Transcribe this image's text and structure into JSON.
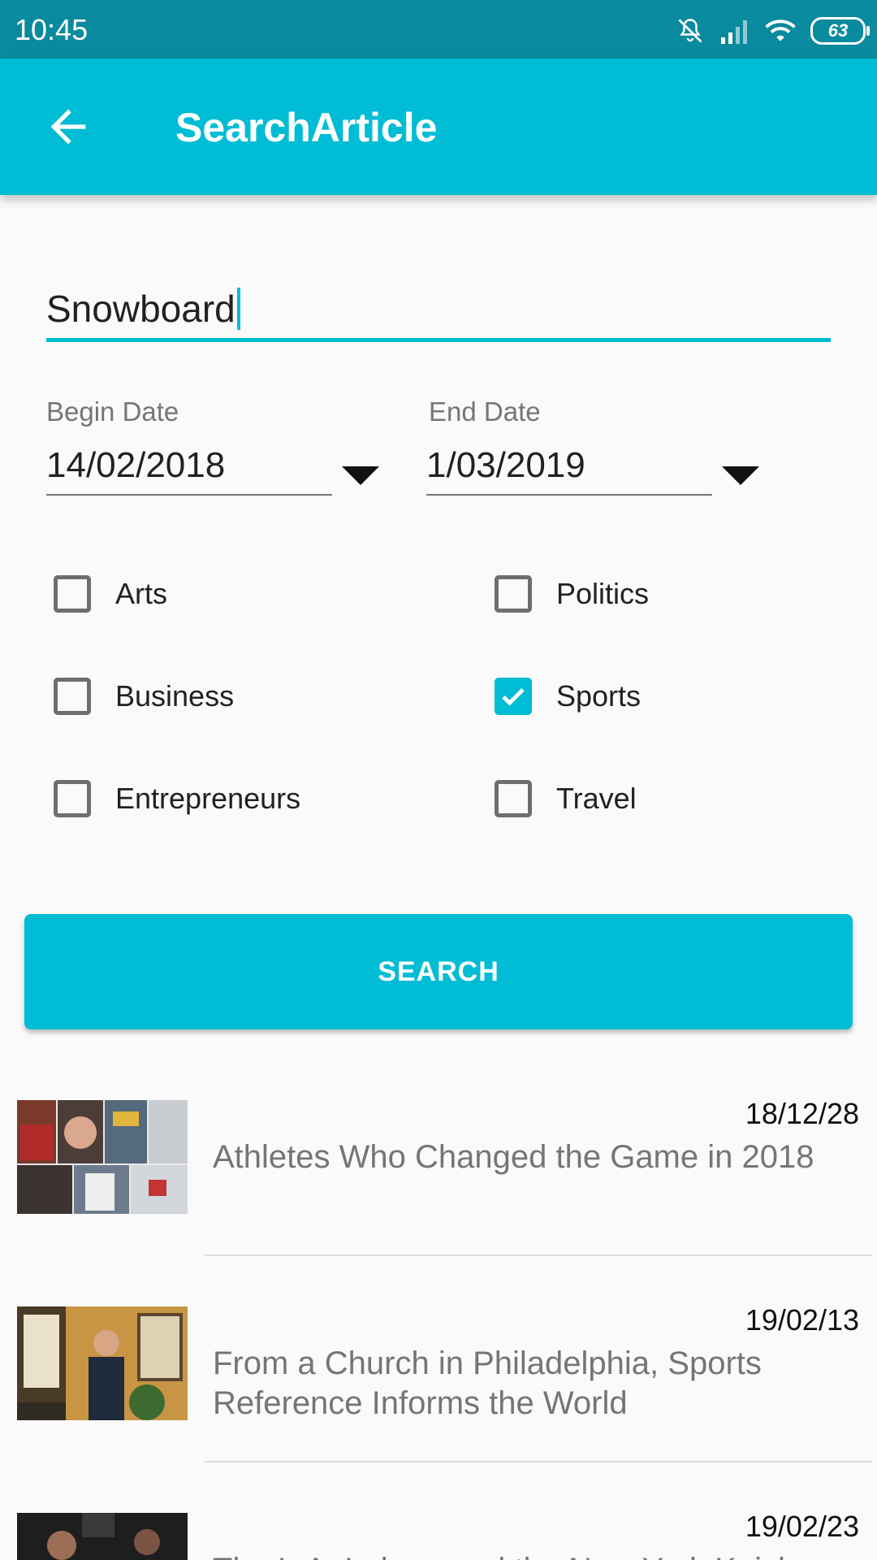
{
  "status_bar": {
    "time": "10:45",
    "battery": "63",
    "icons": [
      "mute-icon",
      "signal-icon",
      "wifi-icon",
      "battery-icon"
    ]
  },
  "app_bar": {
    "title": "SearchArticle",
    "back_icon": "arrow-left-icon"
  },
  "search": {
    "query": "Snowboard"
  },
  "dates": {
    "begin_label": "Begin Date",
    "begin_value": "14/02/2018",
    "end_label": "End Date",
    "end_value": "1/03/2019"
  },
  "categories": [
    {
      "label": "Arts",
      "checked": false
    },
    {
      "label": "Politics",
      "checked": false
    },
    {
      "label": "Business",
      "checked": false
    },
    {
      "label": "Sports",
      "checked": true
    },
    {
      "label": "Entrepreneurs",
      "checked": false
    },
    {
      "label": "Travel",
      "checked": false
    }
  ],
  "search_button": {
    "label": "SEARCH"
  },
  "articles": [
    {
      "date": "18/12/28",
      "title": "Athletes Who Changed the Game in 2018"
    },
    {
      "date": "19/02/13",
      "title": "From a Church in Philadelphia, Sports Reference Informs the World"
    },
    {
      "date": "19/02/23",
      "title": "The L.A. Lakers and the New York Knicks: a Look at..."
    }
  ],
  "colors": {
    "primary": "#00bcd4",
    "status_bar": "#0a8a9e",
    "background": "#fafafa"
  }
}
